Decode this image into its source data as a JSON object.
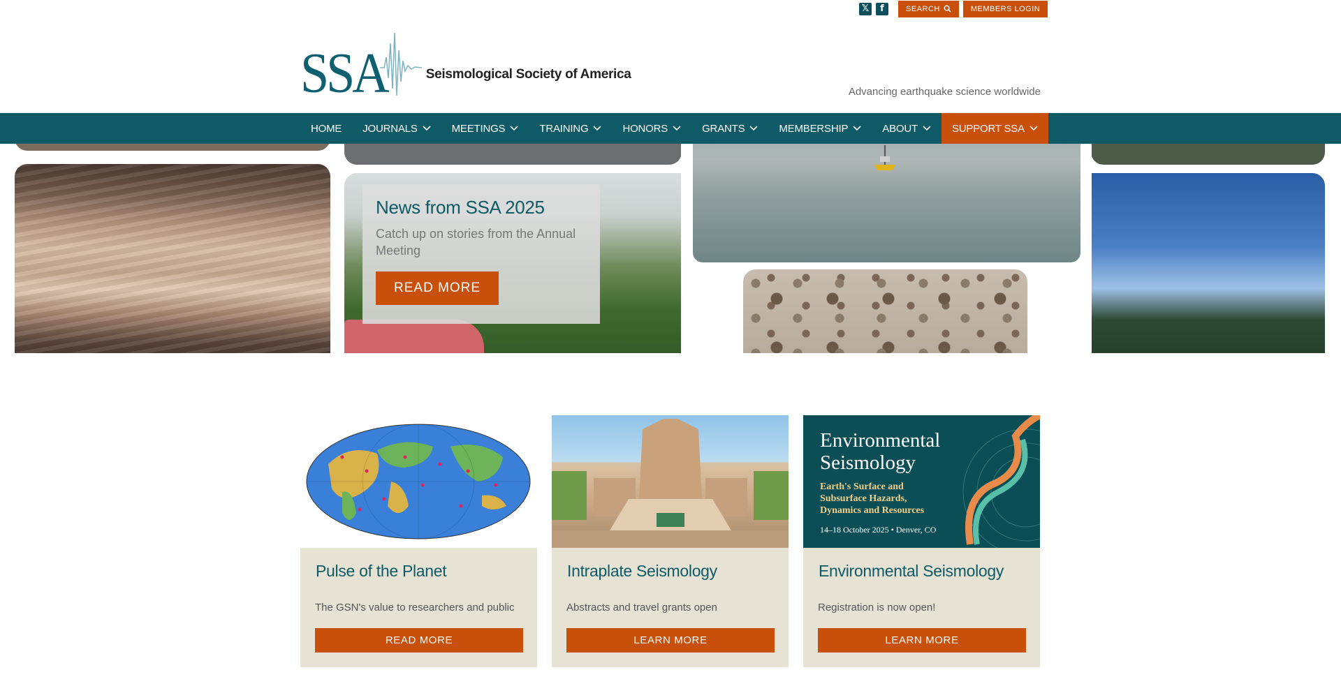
{
  "utility": {
    "search_label": "SEARCH",
    "login_label": "MEMBERS LOGIN",
    "social": [
      {
        "icon": "x-twitter-icon",
        "glyph": "𝕏"
      },
      {
        "icon": "facebook-icon",
        "glyph": "f"
      }
    ]
  },
  "header": {
    "logo_mark": "SSA",
    "logo_name": "Seismological Society of America",
    "tagline": "Advancing earthquake science worldwide"
  },
  "nav": {
    "items": [
      {
        "label": "HOME",
        "dropdown": false
      },
      {
        "label": "JOURNALS",
        "dropdown": true
      },
      {
        "label": "MEETINGS",
        "dropdown": true
      },
      {
        "label": "TRAINING",
        "dropdown": true
      },
      {
        "label": "HONORS",
        "dropdown": true
      },
      {
        "label": "GRANTS",
        "dropdown": true
      },
      {
        "label": "MEMBERSHIP",
        "dropdown": true
      },
      {
        "label": "ABOUT",
        "dropdown": true
      },
      {
        "label": "SUPPORT SSA",
        "dropdown": true
      }
    ]
  },
  "hero": {
    "title": "News from SSA 2025",
    "subtitle": "Catch up on stories from the Annual Meeting",
    "button": "READ MORE"
  },
  "cards": [
    {
      "title": "Pulse of the Planet",
      "desc": "The GSN's value to researchers and public",
      "button": "READ MORE"
    },
    {
      "title": "Intraplate Seismology",
      "desc": "Abstracts and travel grants open",
      "button": "LEARN MORE"
    },
    {
      "title": "Environmental Seismology",
      "desc": "Registration is now open!",
      "button": "LEARN MORE",
      "image_text": {
        "title_line1": "Environmental",
        "title_line2": "Seismology",
        "subtitle_line1": "Earth's Surface and",
        "subtitle_line2": "Subsurface Hazards,",
        "subtitle_line3": "Dynamics and Resources",
        "date": "14–18 October 2025 • Denver, CO"
      }
    }
  ],
  "colors": {
    "brand_teal": "#0e5a66",
    "accent_orange": "#c8500b",
    "card_bg": "#e6e2d4"
  }
}
